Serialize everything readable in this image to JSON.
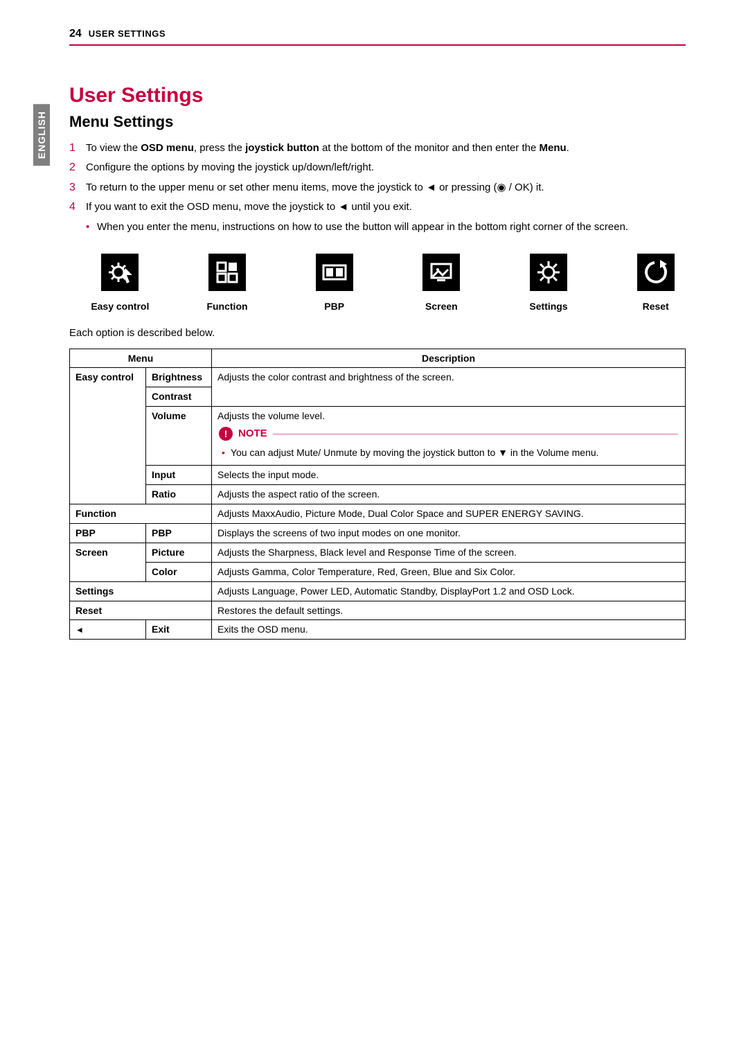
{
  "header": {
    "page_num": "24",
    "label": "USER SETTINGS"
  },
  "side_tab": "ENGLISH",
  "title": "User Settings",
  "subtitle": "Menu Settings",
  "steps": [
    {
      "num": "1",
      "pre": "To view the ",
      "b1": "OSD menu",
      "mid": ", press the ",
      "b2": "joystick button",
      "post": " at the bottom of the monitor and then enter the ",
      "b3": "Menu",
      "end": "."
    },
    {
      "num": "2",
      "text": "Configure the options by moving the joystick up/down/left/right."
    },
    {
      "num": "3",
      "text": "To return to the upper menu or set other menu items, move the joystick to ◄ or pressing (◉ / OK) it."
    },
    {
      "num": "4",
      "text": "If you want to exit the OSD menu, move the joystick to ◄ until you exit."
    }
  ],
  "info_bullet": "When you enter the menu, instructions on how to use the button will appear in the bottom right corner of the screen.",
  "icons": [
    {
      "name": "easy-control-icon",
      "label": "Easy control"
    },
    {
      "name": "function-icon",
      "label": "Function"
    },
    {
      "name": "pbp-icon",
      "label": "PBP"
    },
    {
      "name": "screen-icon",
      "label": "Screen"
    },
    {
      "name": "settings-icon",
      "label": "Settings"
    },
    {
      "name": "reset-icon",
      "label": "Reset"
    }
  ],
  "desc_intro": "Each option is described below.",
  "table": {
    "head_menu": "Menu",
    "head_desc": "Description",
    "easy_control": "Easy control",
    "brightness": "Brightness",
    "contrast": "Contrast",
    "bc_desc": "Adjusts the color contrast and brightness of the screen.",
    "volume": "Volume",
    "volume_desc": "Adjusts the volume level.",
    "note_label": "NOTE",
    "note_text": "You can adjust Mute/ Unmute by moving the joystick button to ▼ in the Volume menu.",
    "input": "Input",
    "input_desc": "Selects the input mode.",
    "ratio": "Ratio",
    "ratio_desc": "Adjusts the aspect ratio of the screen.",
    "function": "Function",
    "function_desc": "Adjusts MaxxAudio, Picture Mode, Dual Color Space and SUPER ENERGY SAVING.",
    "pbp": "PBP",
    "pbp_sub": "PBP",
    "pbp_desc": "Displays the screens of two input modes on one monitor.",
    "screen": "Screen",
    "picture": "Picture",
    "picture_desc": "Adjusts the Sharpness, Black level and Response Time of the screen.",
    "color": "Color",
    "color_desc": "Adjusts Gamma, Color Temperature, Red, Green, Blue and Six Color.",
    "settings": "Settings",
    "settings_desc": "Adjusts Language, Power LED, Automatic Standby, DisplayPort 1.2 and OSD Lock.",
    "reset": "Reset",
    "reset_desc": "Restores the default settings.",
    "left_arrow": "◄",
    "exit": "Exit",
    "exit_desc": "Exits the OSD menu."
  }
}
